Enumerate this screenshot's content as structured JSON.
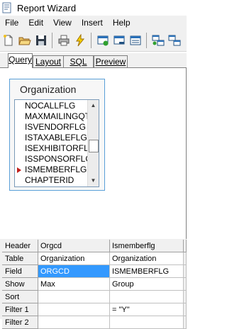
{
  "window": {
    "title": "Report Wizard"
  },
  "menu": [
    "File",
    "Edit",
    "View",
    "Insert",
    "Help"
  ],
  "tabs": [
    {
      "label": "Query",
      "active": true
    },
    {
      "label": "Layout",
      "active": false
    },
    {
      "label": "SQL",
      "active": false
    },
    {
      "label": "Preview",
      "active": false
    }
  ],
  "table_box": {
    "title": "Organization",
    "fields": [
      "NOCALLFLG",
      "MAXMAILINGQTY",
      "ISVENDORFLG",
      "ISTAXABLEFLG",
      "ISEXHIBITORFLG",
      "ISSPONSORFLG",
      "ISMEMBERFLG",
      "CHAPTERID"
    ],
    "marked_field": "ISMEMBERFLG"
  },
  "grid": {
    "rows": [
      {
        "header": "Header",
        "c1": "Orgcd",
        "c2": "Ismemberflg"
      },
      {
        "header": "Table",
        "c1": "Organization",
        "c2": "Organization"
      },
      {
        "header": "Field",
        "c1": "ORGCD",
        "c2": "ISMEMBERFLG"
      },
      {
        "header": "Show",
        "c1": "Max",
        "c2": "Group"
      },
      {
        "header": "Sort",
        "c1": "",
        "c2": ""
      },
      {
        "header": "Filter 1",
        "c1": "",
        "c2": "= \"Y\""
      },
      {
        "header": "Filter 2",
        "c1": "",
        "c2": ""
      }
    ],
    "selected_cell": "ORGCD"
  },
  "colors": {
    "selection": "#3399ff",
    "marker": "#c0201c",
    "box_border": "#5aa0d8"
  }
}
